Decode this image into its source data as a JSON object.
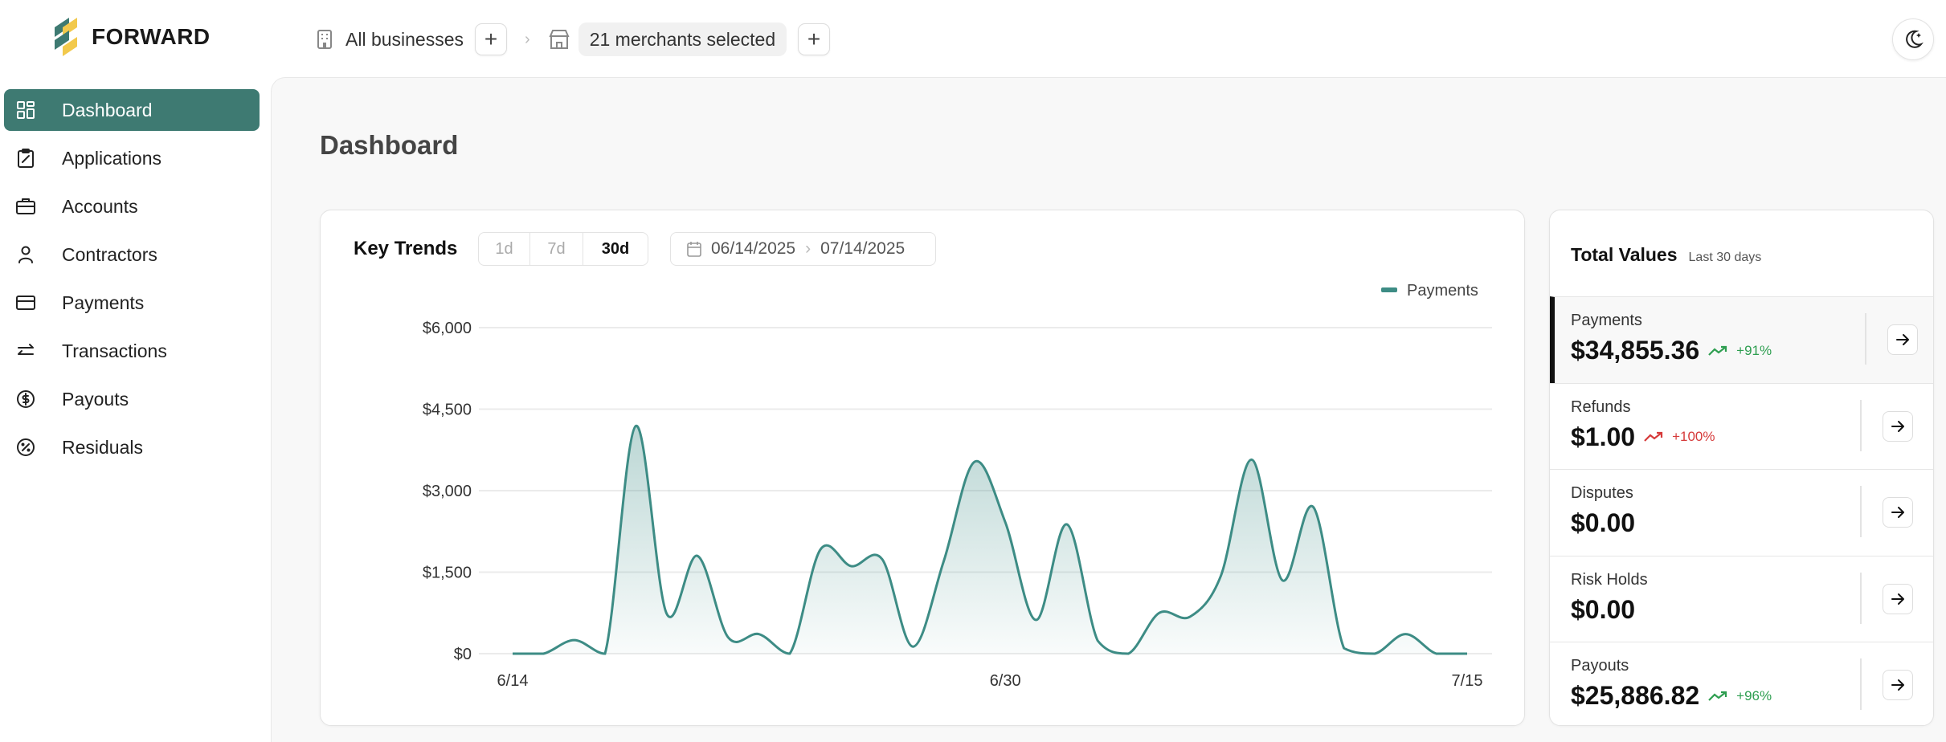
{
  "brand": {
    "name": "FORWARD"
  },
  "breadcrumb": {
    "business": "All businesses",
    "merchants": "21 merchants selected"
  },
  "sidebar": {
    "items": [
      {
        "label": "Dashboard",
        "icon": "grid-icon",
        "active": true
      },
      {
        "label": "Applications",
        "icon": "clipboard-icon"
      },
      {
        "label": "Accounts",
        "icon": "briefcase-icon"
      },
      {
        "label": "Contractors",
        "icon": "user-icon"
      },
      {
        "label": "Payments",
        "icon": "credit-card-icon"
      },
      {
        "label": "Transactions",
        "icon": "arrows-swap-icon"
      },
      {
        "label": "Payouts",
        "icon": "dollar-circle-icon"
      },
      {
        "label": "Residuals",
        "icon": "percent-icon"
      }
    ]
  },
  "page": {
    "title": "Dashboard"
  },
  "trends": {
    "title": "Key Trends",
    "ranges": [
      "1d",
      "7d",
      "30d"
    ],
    "selected_range": "30d",
    "start_date": "06/14/2025",
    "end_date": "07/14/2025"
  },
  "totals": {
    "title": "Total Values",
    "subtitle": "Last 30 days",
    "rows": [
      {
        "label": "Payments",
        "value": "$34,855.36",
        "change": "+91%",
        "trend": "up-good"
      },
      {
        "label": "Refunds",
        "value": "$1.00",
        "change": "+100%",
        "trend": "up-bad"
      },
      {
        "label": "Disputes",
        "value": "$0.00"
      },
      {
        "label": "Risk Holds",
        "value": "$0.00"
      },
      {
        "label": "Payouts",
        "value": "$25,886.82",
        "change": "+96%",
        "trend": "up-good"
      }
    ]
  },
  "colors": {
    "accent": "#3e7a72",
    "line": "#3d8c85",
    "good": "#2e9e50",
    "bad": "#d63a3a"
  },
  "chart_data": {
    "type": "area",
    "title": "",
    "xlabel": "",
    "ylabel": "",
    "legend": [
      "Payments"
    ],
    "legend_position": "top-right",
    "ylim": [
      0,
      6000
    ],
    "yticks": [
      0,
      1500,
      3000,
      4500,
      6000
    ],
    "ytick_labels": [
      "$0",
      "$1,500",
      "$3,000",
      "$4,500",
      "$6,000"
    ],
    "xtick_labels": [
      {
        "index": 0,
        "label": "6/14"
      },
      {
        "index": 16,
        "label": "6/30"
      },
      {
        "index": 31,
        "label": "7/15"
      }
    ],
    "series": [
      {
        "name": "Payments",
        "values": [
          0,
          0,
          250,
          0,
          4190,
          740,
          1800,
          300,
          360,
          0,
          1920,
          1610,
          1740,
          130,
          1700,
          3530,
          2420,
          620,
          2380,
          240,
          0,
          750,
          680,
          1430,
          3570,
          1350,
          2700,
          100,
          0,
          360,
          0,
          0
        ]
      }
    ]
  }
}
